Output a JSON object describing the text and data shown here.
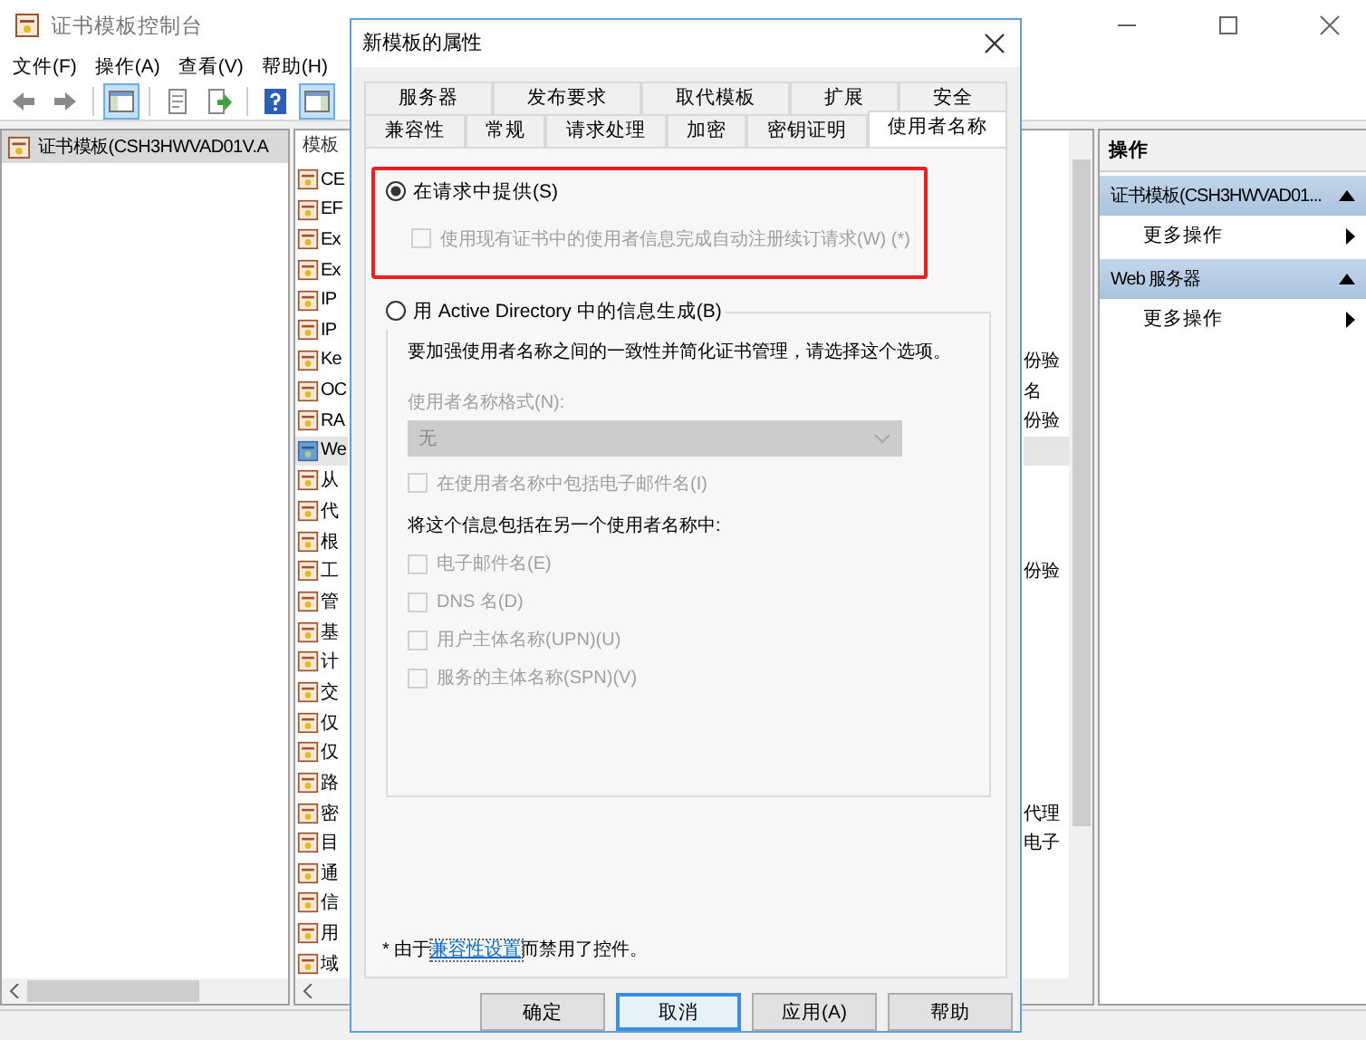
{
  "window": {
    "title": "证书模板控制台"
  },
  "menu": [
    "文件(F)",
    "操作(A)",
    "查看(V)",
    "帮助(H)"
  ],
  "toolbar": [
    {
      "kind": "back",
      "selected": false
    },
    {
      "kind": "forward",
      "selected": false
    },
    {
      "kind": "separator"
    },
    {
      "kind": "tree-pane",
      "selected": true
    },
    {
      "kind": "separator"
    },
    {
      "kind": "document",
      "selected": false
    },
    {
      "kind": "export",
      "selected": false
    },
    {
      "kind": "separator"
    },
    {
      "kind": "help",
      "selected": false
    },
    {
      "kind": "action-pane",
      "selected": true
    }
  ],
  "tree": {
    "items": [
      {
        "label": "证书模板(CSH3HWVAD01V.A",
        "selected": true
      }
    ]
  },
  "list": {
    "column_1": "模板",
    "rows": [
      {
        "name": "CE",
        "selected": false
      },
      {
        "name": "EF",
        "selected": false
      },
      {
        "name": "Ex",
        "selected": false
      },
      {
        "name": "Ex",
        "selected": false
      },
      {
        "name": "IP",
        "selected": false
      },
      {
        "name": "IP",
        "selected": false
      },
      {
        "name": "Ke",
        "column_3": "份验",
        "selected": false
      },
      {
        "name": "OC",
        "column_3": "名",
        "selected": false
      },
      {
        "name": "RA",
        "column_3": "份验",
        "selected": false
      },
      {
        "name": "We",
        "selected": true
      },
      {
        "name": "从",
        "selected": false
      },
      {
        "name": "代",
        "selected": false
      },
      {
        "name": "根",
        "selected": false
      },
      {
        "name": "工",
        "column_3": "份验",
        "selected": false
      },
      {
        "name": "管",
        "selected": false
      },
      {
        "name": "基",
        "selected": false
      },
      {
        "name": "计",
        "selected": false
      },
      {
        "name": "交",
        "selected": false
      },
      {
        "name": "仅",
        "selected": false
      },
      {
        "name": "仅",
        "selected": false
      },
      {
        "name": "路",
        "selected": false
      },
      {
        "name": "密",
        "column_3": "代理",
        "selected": false
      },
      {
        "name": "目",
        "column_3": "电子",
        "selected": false
      },
      {
        "name": "通",
        "selected": false
      },
      {
        "name": "信",
        "selected": false
      },
      {
        "name": "用",
        "selected": false
      },
      {
        "name": "域",
        "selected": false
      }
    ]
  },
  "actions": {
    "title": "操作",
    "groups": [
      {
        "title": "证书模板(CSH3HWVAD01...",
        "expanded": true,
        "items": [
          "更多操作"
        ]
      },
      {
        "title": "Web 服务器",
        "expanded": true,
        "items": [
          "更多操作"
        ]
      }
    ]
  },
  "dialog": {
    "title": "新模板的属性",
    "tab_rows": [
      [
        {
          "label": "服务器",
          "selected": false
        },
        {
          "label": "发布要求",
          "selected": false
        },
        {
          "label": "取代模板",
          "selected": false
        },
        {
          "label": "扩展",
          "selected": false
        },
        {
          "label": "安全",
          "selected": false
        }
      ],
      [
        {
          "label": "兼容性",
          "selected": false
        },
        {
          "label": "常规",
          "selected": false
        },
        {
          "label": "请求处理",
          "selected": false
        },
        {
          "label": "加密",
          "selected": false
        },
        {
          "label": "密钥证明",
          "selected": false
        },
        {
          "label": "使用者名称",
          "selected": true
        }
      ]
    ],
    "supply_in_request": {
      "label": "在请求中提供(S)",
      "selected": true,
      "highlighted": true,
      "renewal_checkbox": {
        "label": "使用现有证书中的使用者信息完成自动注册续订请求(W) (*)",
        "checked": false,
        "disabled": true
      }
    },
    "build_from_ad": {
      "label": "用 Active Directory 中的信息生成(B)",
      "selected": false,
      "description": "要加强使用者名称之间的一致性并简化证书管理，请选择这个选项。",
      "format_label": "使用者名称格式(N):",
      "format_field": {
        "value": "无",
        "disabled": true
      },
      "email_checkbox": {
        "label": "在使用者名称中包括电子邮件名(I)",
        "checked": false,
        "disabled": true
      },
      "alt_label": "将这个信息包括在另一个使用者名称中:",
      "alt_checkboxes": [
        {
          "label": "电子邮件名(E)",
          "checked": false,
          "disabled": true
        },
        {
          "label": "DNS 名(D)",
          "checked": false,
          "disabled": true
        },
        {
          "label": "用户主体名称(UPN)(U)",
          "checked": false,
          "disabled": true
        },
        {
          "label": "服务的主体名称(SPN)(V)",
          "checked": false,
          "disabled": true
        }
      ]
    },
    "footnote": {
      "prefix": "* 由于",
      "link": "兼容性设置",
      "suffix": "而禁用了控件。"
    },
    "buttons": [
      {
        "label": "确定",
        "focused": false
      },
      {
        "label": "取消",
        "focused": true
      },
      {
        "label": "应用(A)",
        "focused": false
      },
      {
        "label": "帮助",
        "focused": false
      }
    ]
  }
}
